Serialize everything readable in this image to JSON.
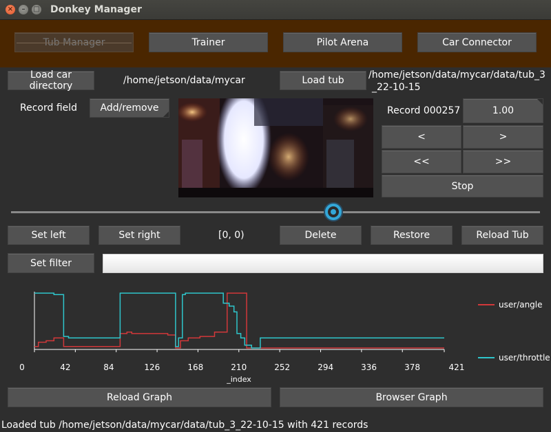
{
  "window": {
    "title": "Donkey Manager"
  },
  "nav": {
    "tub_manager": "Tub Manager",
    "trainer": "Trainer",
    "pilot_arena": "Pilot Arena",
    "car_connector": "Car Connector"
  },
  "car_dir": {
    "button": "Load car directory",
    "path": "/home/jetson/data/mycar"
  },
  "tub": {
    "button": "Load tub",
    "path_line1": "/home/jetson/data/mycar/data/tub_3",
    "path_line2": "_22-10-15"
  },
  "record_field": {
    "label": "Record field",
    "button": "Add/remove"
  },
  "record": {
    "label": "Record 000257",
    "speed": "1.00"
  },
  "controls": {
    "prev": "<",
    "next": ">",
    "rewind": "<<",
    "forward": ">>",
    "stop": "Stop"
  },
  "slider": {
    "position_fraction": 0.61
  },
  "edit": {
    "set_left": "Set left",
    "set_right": "Set right",
    "range": "[0, 0)",
    "delete": "Delete",
    "restore": "Restore",
    "reload_tub": "Reload Tub"
  },
  "filter": {
    "button": "Set filter",
    "value": ""
  },
  "graph": {
    "reload": "Reload Graph",
    "browser": "Browser Graph"
  },
  "status": "Loaded tub /home/jetson/data/mycar/data/tub_3_22-10-15 with 421 records",
  "colors": {
    "angle": "#d2383a",
    "throttle": "#2ec6cc",
    "nav_bg": "#4a2600"
  },
  "chart_data": {
    "type": "line",
    "xlabel": "_index",
    "x_ticks": [
      0,
      42,
      84,
      126,
      168,
      210,
      252,
      294,
      336,
      378,
      421
    ],
    "xlim": [
      0,
      421
    ],
    "ylim": [
      -1,
      1
    ],
    "legend_position": "right",
    "series": [
      {
        "name": "user/angle",
        "points": [
          [
            0,
            -0.9
          ],
          [
            4,
            -0.9
          ],
          [
            4,
            -0.75
          ],
          [
            12,
            -0.75
          ],
          [
            12,
            -0.7
          ],
          [
            20,
            -0.7
          ],
          [
            20,
            -0.6
          ],
          [
            30,
            -0.6
          ],
          [
            30,
            -0.9
          ],
          [
            88,
            -0.9
          ],
          [
            88,
            -0.45
          ],
          [
            95,
            -0.45
          ],
          [
            95,
            -0.4
          ],
          [
            100,
            -0.4
          ],
          [
            100,
            -0.45
          ],
          [
            137,
            -0.45
          ],
          [
            137,
            -0.5
          ],
          [
            145,
            -0.5
          ],
          [
            145,
            -0.95
          ],
          [
            150,
            -0.95
          ],
          [
            150,
            -0.7
          ],
          [
            158,
            -0.7
          ],
          [
            158,
            -0.6
          ],
          [
            170,
            -0.6
          ],
          [
            170,
            -0.55
          ],
          [
            185,
            -0.55
          ],
          [
            185,
            -0.4
          ],
          [
            198,
            -0.4
          ],
          [
            198,
            0.95
          ],
          [
            218,
            0.95
          ],
          [
            218,
            -0.95
          ],
          [
            421,
            -0.95
          ]
        ]
      },
      {
        "name": "user/throttle",
        "points": [
          [
            0,
            0.95
          ],
          [
            20,
            0.95
          ],
          [
            20,
            0.9
          ],
          [
            30,
            0.9
          ],
          [
            30,
            -0.55
          ],
          [
            35,
            -0.55
          ],
          [
            35,
            -0.6
          ],
          [
            88,
            -0.6
          ],
          [
            88,
            0.95
          ],
          [
            145,
            0.95
          ],
          [
            145,
            -0.9
          ],
          [
            148,
            -0.9
          ],
          [
            148,
            -0.6
          ],
          [
            152,
            -0.6
          ],
          [
            152,
            0.9
          ],
          [
            155,
            0.9
          ],
          [
            155,
            0.95
          ],
          [
            194,
            0.95
          ],
          [
            194,
            0.6
          ],
          [
            200,
            0.6
          ],
          [
            200,
            0.5
          ],
          [
            205,
            0.5
          ],
          [
            205,
            0.3
          ],
          [
            208,
            0.3
          ],
          [
            208,
            -0.45
          ],
          [
            212,
            -0.45
          ],
          [
            212,
            -0.6
          ],
          [
            216,
            -0.6
          ],
          [
            216,
            -0.85
          ],
          [
            223,
            -0.85
          ],
          [
            223,
            -0.95
          ],
          [
            232,
            -0.95
          ],
          [
            232,
            -0.6
          ],
          [
            421,
            -0.6
          ]
        ]
      }
    ]
  }
}
